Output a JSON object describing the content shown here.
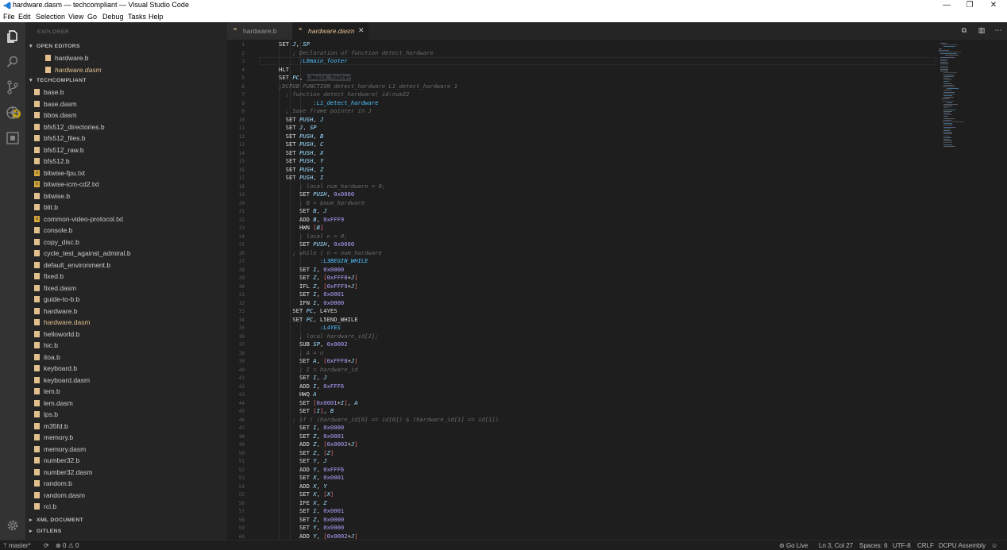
{
  "window": {
    "title": "hardware.dasm — techcompliant — Visual Studio Code",
    "controls": {
      "minimize": "—",
      "maximize": "❐",
      "close": "✕"
    }
  },
  "menu": [
    "File",
    "Edit",
    "Selection",
    "View",
    "Go",
    "Debug",
    "Tasks",
    "Help"
  ],
  "activity_bar": {
    "scm_badge": "4"
  },
  "sidebar": {
    "title": "EXPLORER",
    "open_editors": {
      "label": "OPEN EDITORS",
      "items": [
        "hardware.b",
        "hardware.dasm"
      ]
    },
    "project": {
      "label": "TECHCOMPLIANT",
      "files": [
        "base.b",
        "base.dasm",
        "bbos.dasm",
        "bfs512_directories.b",
        "bfs512_files.b",
        "bfs512_raw.b",
        "bfs512.b",
        "bitwise-fpu.txt",
        "bitwise-icm-cd2.txt",
        "bitwise.b",
        "blit.b",
        "common-video-protocol.txt",
        "console.b",
        "copy_disc.b",
        "cycle_test_against_admiral.b",
        "default_environment.b",
        "fixed.b",
        "fixed.dasm",
        "guide-to-b.b",
        "hardware.b",
        "hardware.dasm",
        "helloworld.b",
        "hic.b",
        "itoa.b",
        "keyboard.b",
        "keyboard.dasm",
        "lem.b",
        "lem.dasm",
        "lps.b",
        "m35fd.b",
        "memory.b",
        "memory.dasm",
        "number32.b",
        "number32.dasm",
        "random.b",
        "random.dasm",
        "rci.b"
      ]
    },
    "collapsed_sections": [
      "XML DOCUMENT",
      "GITLENS"
    ]
  },
  "tabs": [
    {
      "label": "hardware.b"
    },
    {
      "label": "hardware.dasm"
    }
  ],
  "tab_close": "✕",
  "editor": {
    "lines": [
      [
        [
          "k",
          "SET "
        ],
        [
          "r",
          "J"
        ],
        [
          "k",
          ", "
        ],
        [
          "r",
          "SP"
        ]
      ],
      [
        [
          "c",
          "    ; Declaration of function detect_hardware"
        ]
      ],
      [
        [
          "lbl-t",
          "      :L0main_footer"
        ]
      ],
      [
        [
          "k",
          "HLT"
        ]
      ],
      [
        [
          "k",
          "SET "
        ],
        [
          "r",
          "PC"
        ],
        [
          "k",
          ", "
        ],
        [
          "hl",
          "L0main_footer"
        ]
      ],
      [
        [
          "c",
          ";DCPUB FUNCTION detect_hardware L1_detect_hardware 1"
        ]
      ],
      [
        [
          "c",
          "  ; function detect_hardware( id:num32"
        ]
      ],
      [
        [
          "lbl-t",
          "          :L1_detect_hardware"
        ]
      ],
      [
        [
          "c",
          "  ; Save frame pointer in J"
        ]
      ],
      [
        [
          "k",
          "  SET "
        ],
        [
          "r",
          "PUSH"
        ],
        [
          "k",
          ", "
        ],
        [
          "r",
          "J"
        ]
      ],
      [
        [
          "k",
          "  SET "
        ],
        [
          "r",
          "J"
        ],
        [
          "k",
          ", "
        ],
        [
          "r",
          "SP"
        ]
      ],
      [
        [
          "k",
          "  SET "
        ],
        [
          "r",
          "PUSH"
        ],
        [
          "k",
          ", "
        ],
        [
          "r",
          "B"
        ]
      ],
      [
        [
          "k",
          "  SET "
        ],
        [
          "r",
          "PUSH"
        ],
        [
          "k",
          ", "
        ],
        [
          "r",
          "C"
        ]
      ],
      [
        [
          "k",
          "  SET "
        ],
        [
          "r",
          "PUSH"
        ],
        [
          "k",
          ", "
        ],
        [
          "r",
          "X"
        ]
      ],
      [
        [
          "k",
          "  SET "
        ],
        [
          "r",
          "PUSH"
        ],
        [
          "k",
          ", "
        ],
        [
          "r",
          "Y"
        ]
      ],
      [
        [
          "k",
          "  SET "
        ],
        [
          "r",
          "PUSH"
        ],
        [
          "k",
          ", "
        ],
        [
          "r",
          "Z"
        ]
      ],
      [
        [
          "k",
          "  SET "
        ],
        [
          "r",
          "PUSH"
        ],
        [
          "k",
          ", "
        ],
        [
          "r",
          "I"
        ]
      ],
      [
        [
          "c",
          "      ; local num_hardware = 0;"
        ]
      ],
      [
        [
          "k",
          "      SET "
        ],
        [
          "r",
          "PUSH"
        ],
        [
          "k",
          ", "
        ],
        [
          "n",
          "0x0000"
        ]
      ],
      [
        [
          "c",
          "      ; B = &num_hardware"
        ]
      ],
      [
        [
          "k",
          "      SET "
        ],
        [
          "r",
          "B"
        ],
        [
          "k",
          ", "
        ],
        [
          "r",
          "J"
        ]
      ],
      [
        [
          "k",
          "      ADD "
        ],
        [
          "r",
          "B"
        ],
        [
          "k",
          ", "
        ],
        [
          "n",
          "0xFFF9"
        ]
      ],
      [
        [
          "k",
          "      HWN "
        ],
        [
          "b",
          "["
        ],
        [
          "r",
          "B"
        ],
        [
          "b",
          "]"
        ]
      ],
      [
        [
          "c",
          "      ; local n = 0;"
        ]
      ],
      [
        [
          "k",
          "      SET "
        ],
        [
          "r",
          "PUSH"
        ],
        [
          "k",
          ", "
        ],
        [
          "n",
          "0x0000"
        ]
      ],
      [
        [
          "c",
          "    ; while ( n < num_hardware"
        ]
      ],
      [
        [
          "lbl-t",
          "            :L3BEGIN_WHILE"
        ]
      ],
      [
        [
          "k",
          "      SET "
        ],
        [
          "r",
          "I"
        ],
        [
          "k",
          ", "
        ],
        [
          "n",
          "0x0000"
        ]
      ],
      [
        [
          "k",
          "      SET "
        ],
        [
          "r",
          "Z"
        ],
        [
          "k",
          ", "
        ],
        [
          "b",
          "["
        ],
        [
          "n",
          "0xFFF8"
        ],
        [
          "k",
          "+"
        ],
        [
          "r",
          "J"
        ],
        [
          "b",
          "]"
        ]
      ],
      [
        [
          "k",
          "      IFL "
        ],
        [
          "r",
          "Z"
        ],
        [
          "k",
          ", "
        ],
        [
          "b",
          "["
        ],
        [
          "n",
          "0xFFF9"
        ],
        [
          "k",
          "+"
        ],
        [
          "r",
          "J"
        ],
        [
          "b",
          "]"
        ]
      ],
      [
        [
          "k",
          "      SET "
        ],
        [
          "r",
          "I"
        ],
        [
          "k",
          ", "
        ],
        [
          "n",
          "0x0001"
        ]
      ],
      [
        [
          "k",
          "      IFN "
        ],
        [
          "r",
          "I"
        ],
        [
          "k",
          ", "
        ],
        [
          "n",
          "0x0000"
        ]
      ],
      [
        [
          "k",
          "    SET "
        ],
        [
          "r",
          "PC"
        ],
        [
          "k",
          ", L4YES"
        ]
      ],
      [
        [
          "k",
          "    SET "
        ],
        [
          "r",
          "PC"
        ],
        [
          "k",
          ", L5END_WHILE"
        ]
      ],
      [
        [
          "lbl-t",
          "            :L4YES"
        ]
      ],
      [
        [
          "c",
          "      ; local hardware_id[2];"
        ]
      ],
      [
        [
          "k",
          "      SUB "
        ],
        [
          "r",
          "SP"
        ],
        [
          "k",
          ", "
        ],
        [
          "n",
          "0x0002"
        ]
      ],
      [
        [
          "c",
          "      ; A = n"
        ]
      ],
      [
        [
          "k",
          "      SET "
        ],
        [
          "r",
          "A"
        ],
        [
          "k",
          ", "
        ],
        [
          "b",
          "["
        ],
        [
          "n",
          "0xFFF8"
        ],
        [
          "k",
          "+"
        ],
        [
          "r",
          "J"
        ],
        [
          "b",
          "]"
        ]
      ],
      [
        [
          "c",
          "      ; I = hardware_id"
        ]
      ],
      [
        [
          "k",
          "      SET "
        ],
        [
          "r",
          "I"
        ],
        [
          "k",
          ", "
        ],
        [
          "r",
          "J"
        ]
      ],
      [
        [
          "k",
          "      ADD "
        ],
        [
          "r",
          "I"
        ],
        [
          "k",
          ", "
        ],
        [
          "n",
          "0xFFF6"
        ]
      ],
      [
        [
          "k",
          "      HWQ "
        ],
        [
          "r",
          "A"
        ]
      ],
      [
        [
          "k",
          "      SET "
        ],
        [
          "b",
          "["
        ],
        [
          "n",
          "0x0001"
        ],
        [
          "k",
          "+"
        ],
        [
          "r",
          "I"
        ],
        [
          "b",
          "]"
        ],
        [
          "k",
          ", "
        ],
        [
          "r",
          "A"
        ]
      ],
      [
        [
          "k",
          "      SET "
        ],
        [
          "b",
          "["
        ],
        [
          "r",
          "I"
        ],
        [
          "b",
          "]"
        ],
        [
          "k",
          ", "
        ],
        [
          "r",
          "B"
        ]
      ],
      [
        [
          "c",
          "    ; if ( (hardware_id[0] == id[0]) & (hardware_id[1] == id[1])"
        ]
      ],
      [
        [
          "k",
          "      SET "
        ],
        [
          "r",
          "I"
        ],
        [
          "k",
          ", "
        ],
        [
          "n",
          "0x0000"
        ]
      ],
      [
        [
          "k",
          "      SET "
        ],
        [
          "r",
          "Z"
        ],
        [
          "k",
          ", "
        ],
        [
          "n",
          "0x0001"
        ]
      ],
      [
        [
          "k",
          "      ADD "
        ],
        [
          "r",
          "Z"
        ],
        [
          "k",
          ", "
        ],
        [
          "b",
          "["
        ],
        [
          "n",
          "0x0002"
        ],
        [
          "k",
          "+"
        ],
        [
          "r",
          "J"
        ],
        [
          "b",
          "]"
        ]
      ],
      [
        [
          "k",
          "      SET "
        ],
        [
          "r",
          "Z"
        ],
        [
          "k",
          ", "
        ],
        [
          "b",
          "["
        ],
        [
          "r",
          "Z"
        ],
        [
          "b",
          "]"
        ]
      ],
      [
        [
          "k",
          "      SET "
        ],
        [
          "r",
          "Y"
        ],
        [
          "k",
          ", "
        ],
        [
          "r",
          "J"
        ]
      ],
      [
        [
          "k",
          "      ADD "
        ],
        [
          "r",
          "Y"
        ],
        [
          "k",
          ", "
        ],
        [
          "n",
          "0xFFF6"
        ]
      ],
      [
        [
          "k",
          "      SET "
        ],
        [
          "r",
          "X"
        ],
        [
          "k",
          ", "
        ],
        [
          "n",
          "0x0001"
        ]
      ],
      [
        [
          "k",
          "      ADD "
        ],
        [
          "r",
          "X"
        ],
        [
          "k",
          ", "
        ],
        [
          "r",
          "Y"
        ]
      ],
      [
        [
          "k",
          "      SET "
        ],
        [
          "r",
          "X"
        ],
        [
          "k",
          ", "
        ],
        [
          "b",
          "["
        ],
        [
          "r",
          "X"
        ],
        [
          "b",
          "]"
        ]
      ],
      [
        [
          "k",
          "      IFE "
        ],
        [
          "r",
          "X"
        ],
        [
          "k",
          ", "
        ],
        [
          "r",
          "Z"
        ]
      ],
      [
        [
          "k",
          "      SET "
        ],
        [
          "r",
          "I"
        ],
        [
          "k",
          ", "
        ],
        [
          "n",
          "0x0001"
        ]
      ],
      [
        [
          "k",
          "      SET "
        ],
        [
          "r",
          "Z"
        ],
        [
          "k",
          ", "
        ],
        [
          "n",
          "0x0000"
        ]
      ],
      [
        [
          "k",
          "      SET "
        ],
        [
          "r",
          "Y"
        ],
        [
          "k",
          ", "
        ],
        [
          "n",
          "0x0000"
        ]
      ],
      [
        [
          "k",
          "      ADD "
        ],
        [
          "r",
          "Y"
        ],
        [
          "k",
          ", "
        ],
        [
          "b",
          "["
        ],
        [
          "n",
          "0x0002"
        ],
        [
          "k",
          "+"
        ],
        [
          "r",
          "J"
        ],
        [
          "b",
          "]"
        ]
      ]
    ]
  },
  "status_bar": {
    "branch": "master*",
    "sync": "⟳",
    "errors": "0",
    "warnings": "0",
    "go_live": "Go Live",
    "position": "Ln 3, Col 27",
    "spaces": "Spaces: 6",
    "encoding": "UTF-8",
    "eol": "CRLF",
    "language": "DCPU Assembly"
  },
  "colors": {
    "accent_file": "#e2c08d",
    "status_badge": "#c8a300",
    "sidebar_bg": "#252526",
    "editor_bg": "#1e1e1e"
  }
}
